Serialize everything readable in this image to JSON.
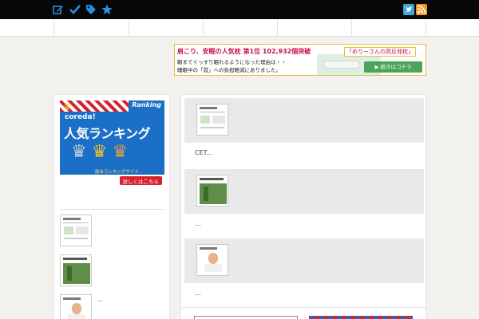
{
  "topbar": {
    "icons": [
      "edit-icon",
      "check-icon",
      "tag-icon",
      "star-icon"
    ],
    "social_icons": [
      "twitter-icon",
      "rss-icon"
    ]
  },
  "banner": {
    "title": "肩こり、安眠の人気枕 第1位 102,932個突破",
    "product_name": "「めりーさんの高反発枕」",
    "line1": "朝までぐっすり眠れるようになった理由は・・",
    "line2": "睡眠中の「首」への負担軽減にありました。",
    "button": "続きはコチラ"
  },
  "sidebar": {
    "ranking_banner": {
      "tag": "Ranking",
      "brand": "coreda!",
      "headline": "人気ランキング",
      "site_label": "総合ランキングサイト",
      "more": "詳しくはこちら"
    },
    "entries": [
      {
        "excerpt": ""
      },
      {
        "excerpt": ""
      },
      {
        "excerpt": "..."
      }
    ]
  },
  "posts": [
    {
      "excerpt": "CET..."
    },
    {
      "excerpt": "..."
    },
    {
      "excerpt": "..."
    }
  ],
  "colors": {
    "topbar": "#070707",
    "accent_red": "#d8202c",
    "accent_blue": "#1c6fc6",
    "banner_pink": "#c8104c",
    "button_green": "#4aa55a"
  }
}
